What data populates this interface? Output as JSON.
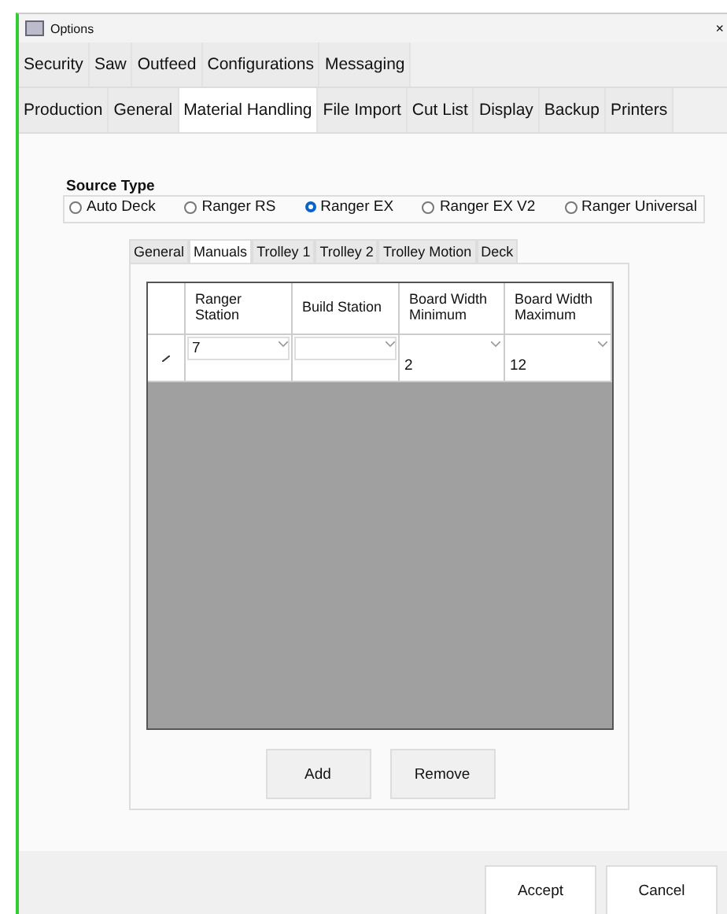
{
  "window": {
    "title": "Options",
    "close": "×"
  },
  "tab_rows": [
    [
      {
        "label": "Security",
        "selected": false
      },
      {
        "label": "Saw",
        "selected": false
      },
      {
        "label": "Outfeed",
        "selected": false
      },
      {
        "label": "Configurations",
        "selected": false
      },
      {
        "label": "Messaging",
        "selected": false
      }
    ],
    [
      {
        "label": "Production",
        "selected": false
      },
      {
        "label": "General",
        "selected": false
      },
      {
        "label": "Material Handling",
        "selected": true
      },
      {
        "label": "File Import",
        "selected": false
      },
      {
        "label": "Cut List",
        "selected": false
      },
      {
        "label": "Display",
        "selected": false
      },
      {
        "label": "Backup",
        "selected": false
      },
      {
        "label": "Printers",
        "selected": false
      }
    ]
  ],
  "source_type": {
    "title": "Source Type",
    "options": [
      {
        "label": "Auto Deck",
        "selected": false
      },
      {
        "label": "Ranger RS",
        "selected": false
      },
      {
        "label": "Ranger EX",
        "selected": true
      },
      {
        "label": "Ranger EX V2",
        "selected": false
      },
      {
        "label": "Ranger Universal",
        "selected": false
      }
    ]
  },
  "inner_tabs": [
    {
      "label": "General",
      "selected": false
    },
    {
      "label": "Manuals",
      "selected": true
    },
    {
      "label": "Trolley 1",
      "selected": false
    },
    {
      "label": "Trolley 2",
      "selected": false
    },
    {
      "label": "Trolley Motion",
      "selected": false
    },
    {
      "label": "Deck",
      "selected": false
    }
  ],
  "table": {
    "columns": [
      "Ranger Station",
      "Build Station",
      "Board Width Minimum",
      "Board Width Maximum"
    ],
    "rows": [
      {
        "cells": [
          "7",
          "",
          "2",
          "12"
        ]
      }
    ]
  },
  "table_buttons": [
    "Add",
    "Remove"
  ],
  "buttons": [
    "Accept",
    "Cancel"
  ]
}
